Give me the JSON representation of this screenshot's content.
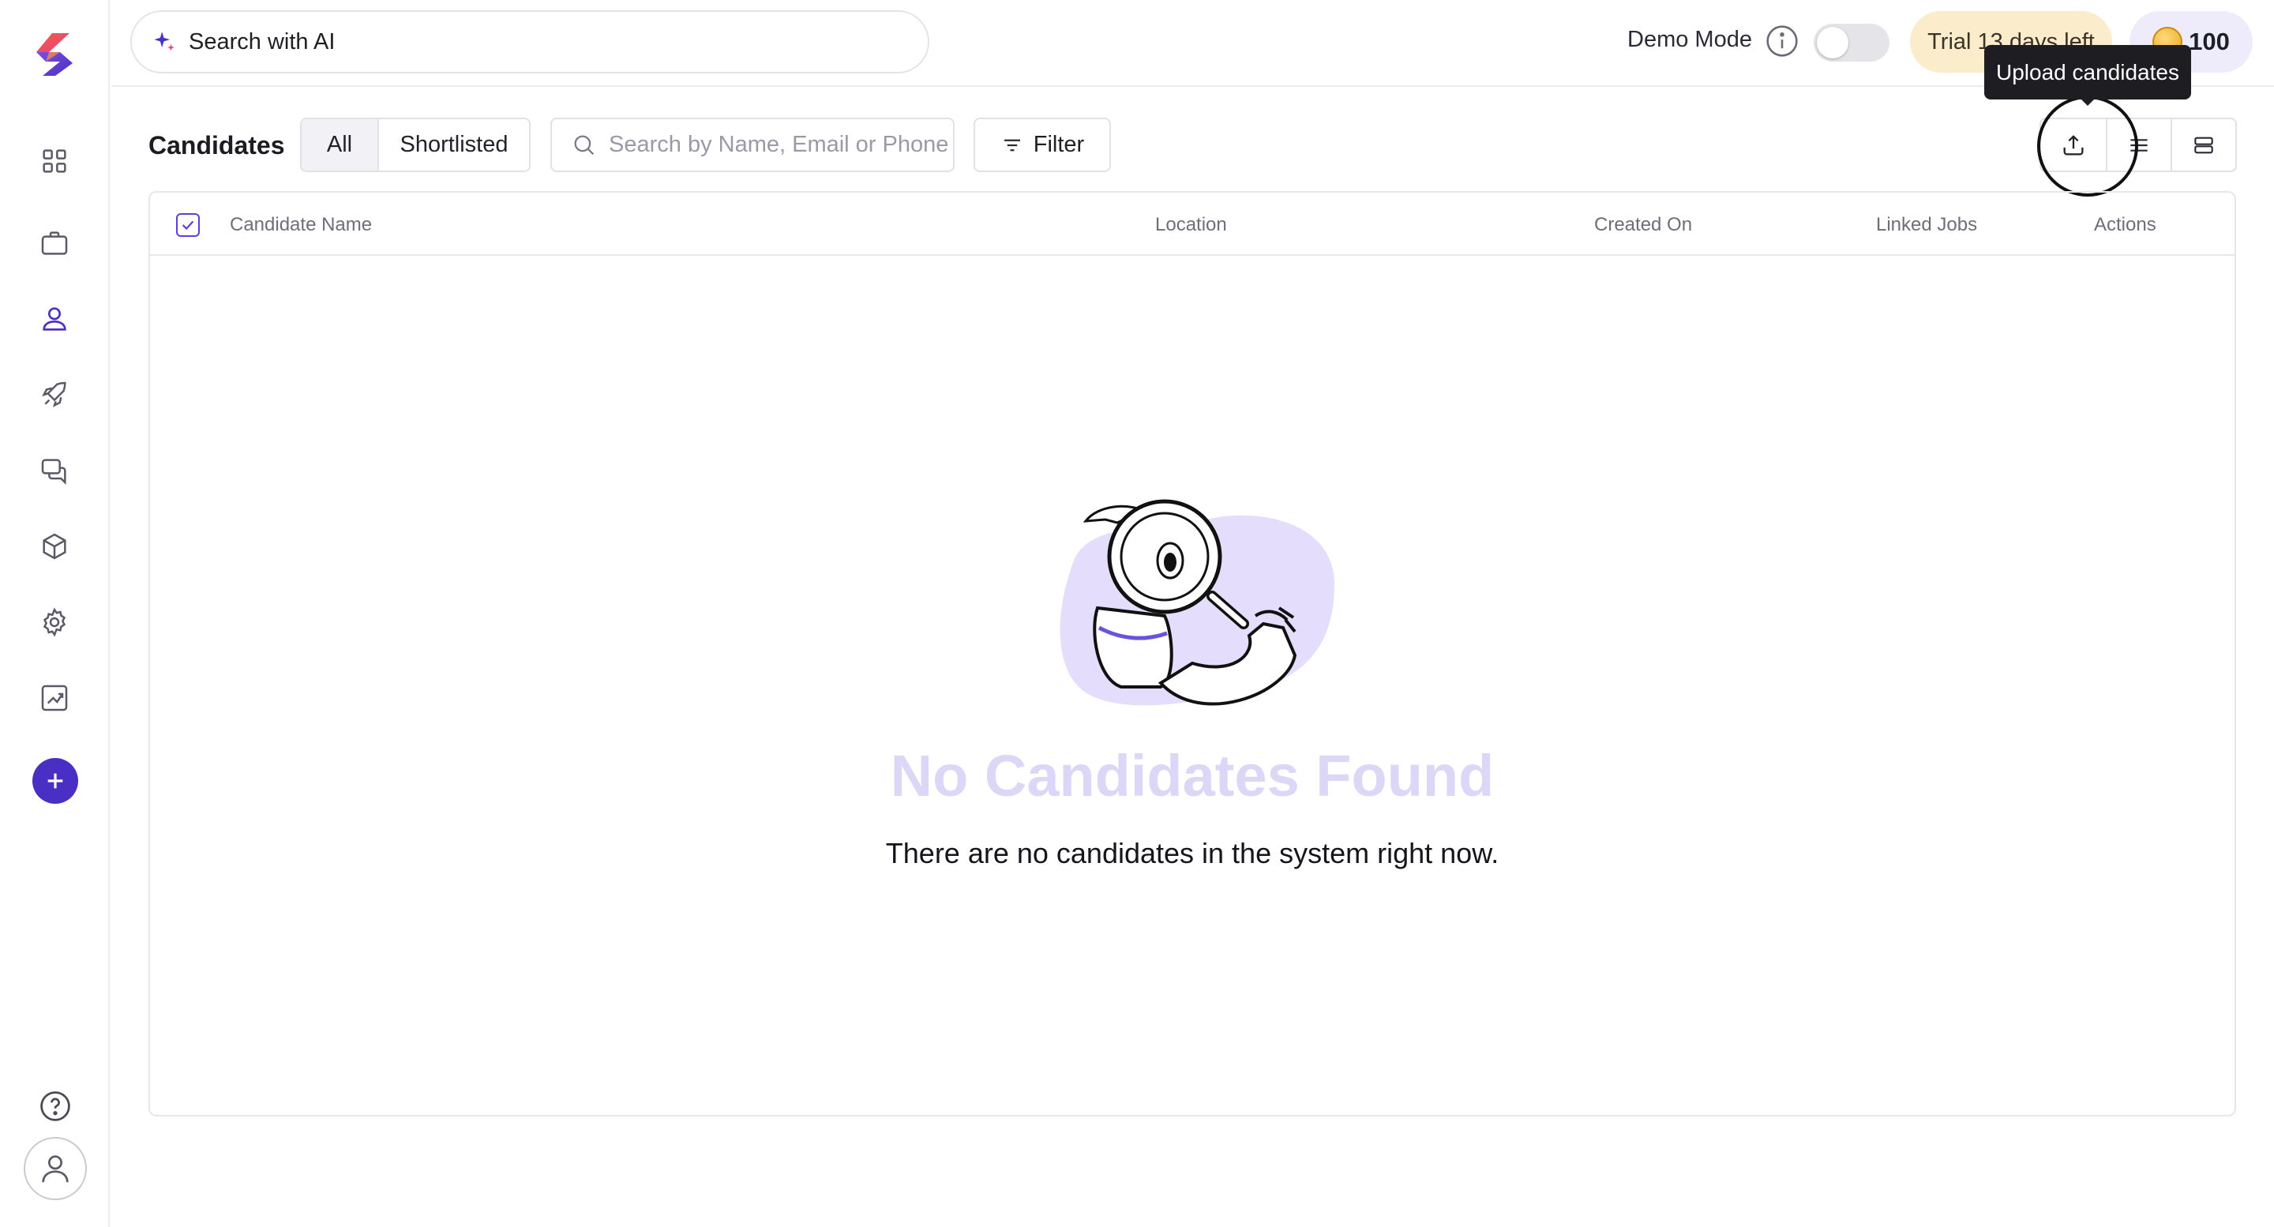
{
  "topbar": {
    "ai_search_placeholder": "Search with AI",
    "demo_mode_label": "Demo Mode",
    "demo_mode_on": false,
    "trial_text": "Trial 13 days left",
    "credits": "100"
  },
  "sidebar": {
    "items": [
      {
        "name": "dashboard",
        "icon": "grid-icon"
      },
      {
        "name": "jobs",
        "icon": "briefcase-icon"
      },
      {
        "name": "candidates",
        "icon": "user-icon",
        "active": true
      },
      {
        "name": "campaigns",
        "icon": "rocket-icon"
      },
      {
        "name": "messages",
        "icon": "chat-icon"
      },
      {
        "name": "integrations",
        "icon": "cube-icon"
      },
      {
        "name": "settings",
        "icon": "gear-icon"
      },
      {
        "name": "analytics",
        "icon": "chart-icon"
      }
    ]
  },
  "page": {
    "title": "Candidates",
    "tabs": [
      {
        "label": "All",
        "active": true
      },
      {
        "label": "Shortlisted",
        "active": false
      }
    ],
    "search_placeholder": "Search by Name, Email or Phone",
    "filter_label": "Filter",
    "tooltip": "Upload candidates"
  },
  "table": {
    "columns": [
      "Candidate Name",
      "Location",
      "Created On",
      "Linked Jobs",
      "Actions"
    ]
  },
  "empty_state": {
    "title": "No Candidates Found",
    "subtitle": "There are no candidates in the system right now."
  },
  "colors": {
    "accent": "#4a2fc4",
    "empty_title": "#dcd6f7",
    "trial_bg": "#fbeccb",
    "credits_bg": "#eeebfb"
  }
}
